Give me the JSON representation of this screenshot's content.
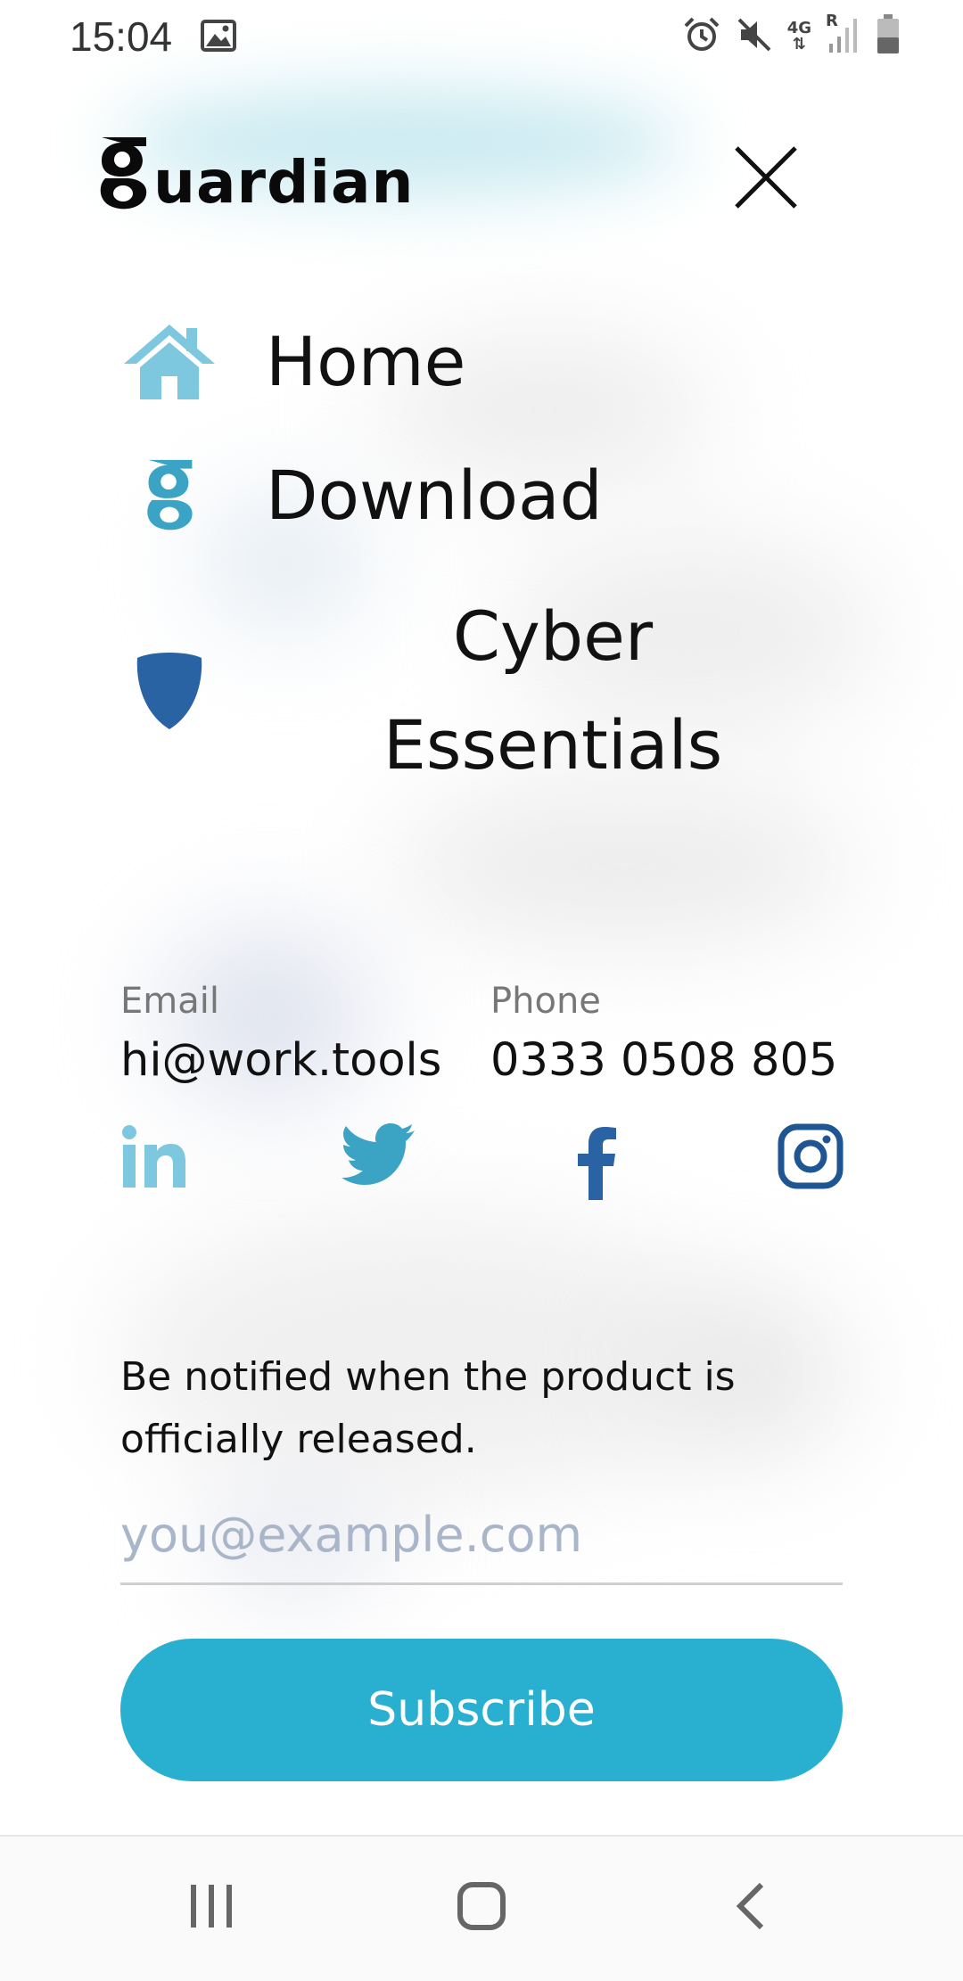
{
  "status_bar": {
    "time": "15:04",
    "network": "4G",
    "roaming": "R",
    "icons": [
      "image-icon",
      "alarm-icon",
      "mute-icon",
      "signal-icon",
      "battery-icon"
    ]
  },
  "header": {
    "logo_mark": "g",
    "logo_word": "uardian",
    "close_icon": "close-icon"
  },
  "menu": {
    "items": [
      {
        "label": "Home",
        "icon": "home-icon"
      },
      {
        "label": "Download",
        "icon": "guardian-g-icon"
      },
      {
        "label": "Cyber Essentials",
        "icon": "shield-icon"
      }
    ]
  },
  "contact": {
    "email_label": "Email",
    "email_value": "hi@work.tools",
    "phone_label": "Phone",
    "phone_value": "0333 0508 805"
  },
  "social": {
    "icons": [
      "linkedin-icon",
      "twitter-icon",
      "facebook-icon",
      "instagram-icon"
    ]
  },
  "subscribe": {
    "notify_text": "Be notified when the product is officially released.",
    "email_placeholder": "you@example.com",
    "email_value": "",
    "button_label": "Subscribe"
  },
  "colors": {
    "accent": "#29afcf",
    "home_icon": "#7ec8df",
    "download_icon": "#3ba3c4",
    "shield_icon": "#2a63a4",
    "linkedin": "#7ec8df",
    "twitter": "#3ba3c4",
    "facebook": "#2a63a4",
    "instagram": "#1f5592"
  },
  "system_nav": {
    "icons": [
      "recents-icon",
      "home-button-icon",
      "back-icon"
    ]
  }
}
